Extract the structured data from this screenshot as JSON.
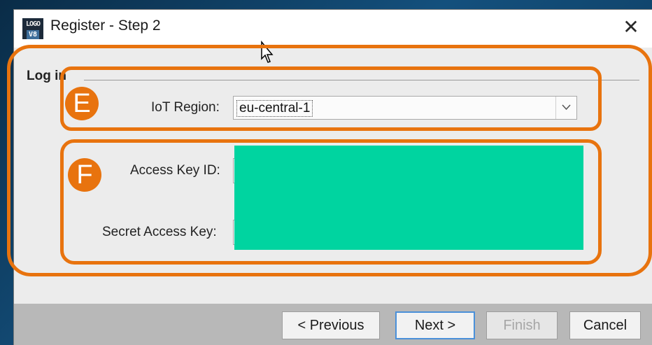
{
  "dialog": {
    "title": "Register - Step 2",
    "close_glyph": "✕"
  },
  "section": {
    "title": "Log in"
  },
  "form": {
    "region_label": "IoT Region:",
    "region_value": "eu-central-1",
    "access_key_label": "Access Key ID:",
    "access_key_value": "",
    "secret_key_label": "Secret Access Key:",
    "secret_key_value": ""
  },
  "annotations": {
    "badge_e": "E",
    "badge_f": "F"
  },
  "buttons": {
    "previous": "< Previous",
    "next": "Next >",
    "finish": "Finish",
    "cancel": "Cancel"
  },
  "colors": {
    "annotation": "#e8730e",
    "redaction": "#00d4a0",
    "default_button_border": "#4a90d9"
  }
}
